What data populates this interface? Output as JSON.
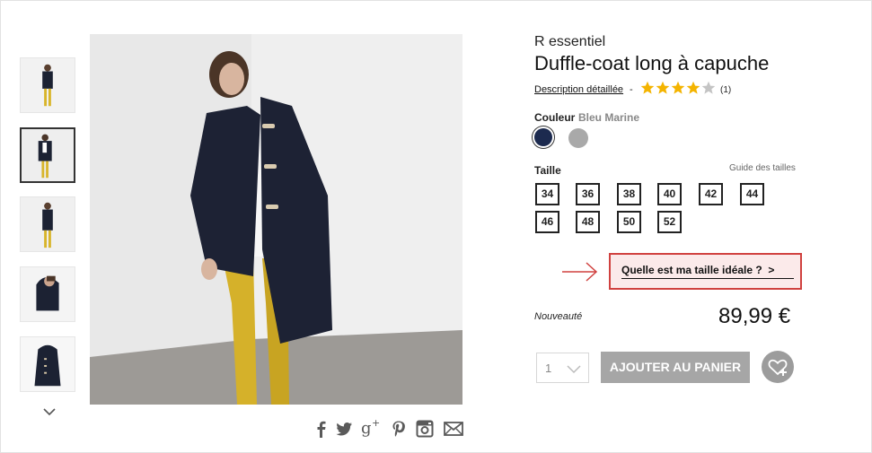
{
  "product": {
    "brand": "R essentiel",
    "title": "Duffle-coat long à capuche",
    "description_link": "Description détaillée",
    "separator": "-",
    "rating_stars": 4,
    "rating_max": 5,
    "rating_count": "(1)"
  },
  "color": {
    "label": "Couleur",
    "selected": "Bleu Marine",
    "swatches": [
      {
        "name": "Bleu Marine",
        "hex": "#1c2a4f"
      },
      {
        "name": "Gris",
        "hex": "#a9a9a9"
      }
    ]
  },
  "size": {
    "label": "Taille",
    "guide": "Guide des tailles",
    "options": [
      "34",
      "36",
      "38",
      "40",
      "42",
      "44",
      "46",
      "48",
      "50",
      "52"
    ]
  },
  "ideal_size_button": "Quelle est ma taille idéale ?",
  "ideal_size_chevron": ">",
  "badge": "Nouveauté",
  "price": "89,99 €",
  "quantity": "1",
  "add_to_cart": "AJOUTER AU PANIER",
  "share_icons": [
    "facebook-icon",
    "twitter-icon",
    "google-plus-icon",
    "pinterest-icon",
    "instagram-icon",
    "email-icon"
  ],
  "colors": {
    "highlight_border": "#d0413f",
    "highlight_bg": "#fbeaea",
    "button_grey": "#a6a6a6",
    "star": "#f4b400"
  }
}
